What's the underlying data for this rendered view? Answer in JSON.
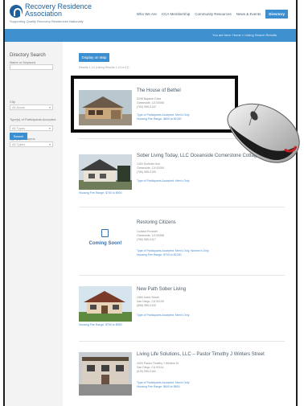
{
  "header": {
    "logo_line1": "Recovery Residence",
    "logo_line2": "Association",
    "tagline": "Supporting Quality Recovery Residences Nationally",
    "nav": [
      "Who We Are",
      "CCA Membership",
      "Community Resources",
      "News & Events",
      "Directory"
    ],
    "active_nav": "Directory",
    "breadcrumb": "You are here: Home » Listing Search Results"
  },
  "sidebar": {
    "title": "Directory Search",
    "keyword_label": "Name or Keyword",
    "city_label": "City",
    "city_value": "All Areas",
    "participants_label": "Type(s) of Participants Accepted",
    "participants_value": "All Types",
    "rooms_label": "Type(s) of Rooms",
    "rooms_value": "All Types",
    "search_button": "Search"
  },
  "main": {
    "map_button": "Display on Map",
    "showing_text": "Results 1-10 (Listing Results 1-10 of 47)",
    "listings": [
      {
        "name": "The House of Bethel",
        "address": "5298 Bayside Drive",
        "city": "Oceanside, CA 92056",
        "phone": "(760) 555-0142",
        "participants": "Type of Participants Accepted: Men's Only",
        "price": "Housing Fee Range: $800 to $1000"
      },
      {
        "name": "Sober Living Today, LLC Oceanside Cornerstone Cottage",
        "address": "1400 Surfrider Ave",
        "city": "Oceanside, CA 92054",
        "phone": "(760) 555-0190",
        "participants": "Type of Participants Accepted: Men's Only",
        "price": "Housing Fee Range: $700 to $900"
      },
      {
        "name": "Restoring Citizens",
        "address": "Contact Provider",
        "city": "Oceanside, CA 92058",
        "phone": "(760) 555-0117",
        "participants": "Type of Participants Accepted: Men's Only, Women's Only",
        "price": "Housing Fee Range: $700 to $1000",
        "placeholder": "Coming Soon!"
      },
      {
        "name": "New Path Sober Living",
        "address": "1960 Irvine Street",
        "city": "San Diego, CA 92109",
        "phone": "(858) 555-0133",
        "participants": "Type of Participants Accepted: Men's Only",
        "price": "Housing Fee Range: $750 to $950"
      },
      {
        "name": "Living Life Solutions, LLC – Pastor Timothy J Winters Street",
        "address": "4420 Pastor Timothy J Winters St",
        "city": "San Diego, CA 92114",
        "phone": "(619) 555-0162",
        "participants": "Type of Participants Accepted: Men's Only",
        "price": "Housing Fee Range: $600 to $800"
      }
    ]
  },
  "colors": {
    "brand_blue": "#3b8fd1",
    "logo_blue": "#1f5f9a",
    "highlight_border": "#0c0c0c"
  }
}
